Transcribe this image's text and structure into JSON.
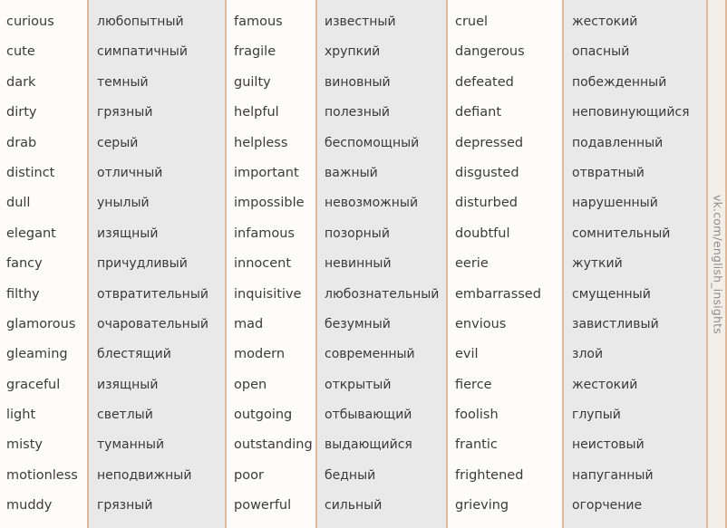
{
  "watermark": {
    "text": "vk.com/english_insights"
  },
  "colors": {
    "divider": "#e0b89a",
    "english_column_bg": "#fdfcfa",
    "russian_column_bg": "#e9e9e9",
    "text": "#3b3b3b",
    "watermark_text": "#8c8c8c"
  },
  "columns": [
    {
      "id": "english-1",
      "language": "english",
      "words": [
        "curious",
        "cute",
        "dark",
        "dirty",
        "drab",
        "distinct",
        "dull",
        "elegant",
        "fancy",
        "filthy",
        "glamorous",
        "gleaming",
        "graceful",
        "light",
        "misty",
        "motionless",
        "muddy"
      ]
    },
    {
      "id": "russian-1",
      "language": "russian",
      "words": [
        "любопытный",
        "симпатичный",
        "темный",
        "грязный",
        "серый",
        "отличный",
        "унылый",
        "изящный",
        "причудливый",
        "отвратительный",
        "очаровательный",
        "блестящий",
        "изящный",
        "светлый",
        "туманный",
        "неподвижный",
        "грязный"
      ]
    },
    {
      "id": "english-2",
      "language": "english",
      "words": [
        "famous",
        "fragile",
        "guilty",
        "helpful",
        "helpless",
        "important",
        "impossible",
        "infamous",
        "innocent",
        "inquisitive",
        "mad",
        "modern",
        "open",
        "outgoing",
        "outstanding",
        "poor",
        "powerful"
      ]
    },
    {
      "id": "russian-2",
      "language": "russian",
      "words": [
        "известный",
        "хрупкий",
        "виновный",
        "полезный",
        "беспомощный",
        "важный",
        "невозможный",
        "позорный",
        "невинный",
        "любознательный",
        "безумный",
        "современный",
        "открытый",
        "отбывающий",
        "выдающийся",
        "бедный",
        "сильный"
      ]
    },
    {
      "id": "english-3",
      "language": "english",
      "words": [
        "cruel",
        "dangerous",
        "defeated",
        "defiant",
        "depressed",
        "disgusted",
        "disturbed",
        "doubtful",
        "eerie",
        "embarrassed",
        "envious",
        "evil",
        "fierce",
        "foolish",
        "frantic",
        "frightened",
        "grieving"
      ]
    },
    {
      "id": "russian-3",
      "language": "russian",
      "words": [
        "жестокий",
        "опасный",
        "побежденный",
        "неповинующийся",
        "подавленный",
        "отвратный",
        "нарушенный",
        "сомнительный",
        "жуткий",
        "смущенный",
        "завистливый",
        "злой",
        "жестокий",
        "глупый",
        "неистовый",
        "напуганный",
        "огорчение"
      ]
    }
  ]
}
